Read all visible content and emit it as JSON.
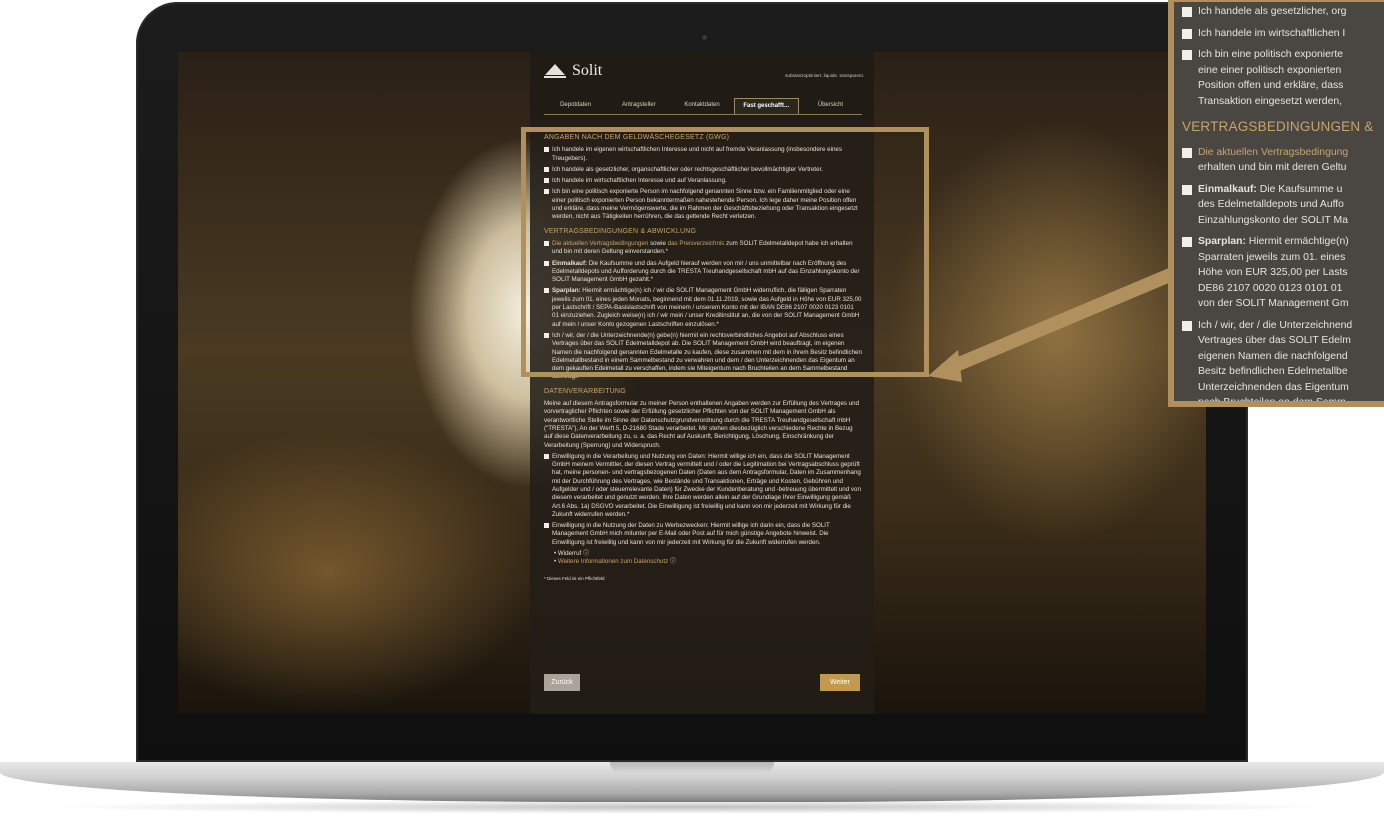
{
  "brand": {
    "name": "Solit",
    "slogan": "substanzoptimiert. liquide. transparent."
  },
  "tabs": [
    {
      "label": "Depotdaten"
    },
    {
      "label": "Antragsteller"
    },
    {
      "label": "Kontaktdaten"
    },
    {
      "label": "Fast geschafft..."
    },
    {
      "label": "Übersicht"
    }
  ],
  "form": {
    "gwg_title": "ANGABEN NACH DEM GELDWÄSCHEGESETZ (GWG)",
    "gwg_items": [
      "Ich handele im eigenen wirtschaftlichen Interesse und nicht auf fremde Veranlassung (insbesondere eines Treugebers).",
      "Ich handele als gesetzlicher, organschaftlicher oder rechtsgeschäftlicher bevollmächtigter Vertreter.",
      "Ich handele im wirtschaftlichen Interesse und auf Veranlassung.",
      "Ich bin eine politisch exponierte Person im nachfolgend genannten Sinne bzw. ein Familienmitglied oder eine einer politisch exponierten Person bekanntermaßen nahestehende Person. Ich lege daher meine Position offen und erkläre, dass meine Vermögenswerte, die im Rahmen der Geschäftsbeziehung oder Transaktion eingesetzt werden, nicht aus Tätigkeiten herrühren, die das geltende Recht verletzen."
    ],
    "contract_title": "VERTRAGSBEDINGUNGEN & ABWICKLUNG",
    "contract_item1_link1": "Die aktuellen Vertragsbedingungen",
    "contract_item1_mid": "sowie",
    "contract_item1_link2": "das Preisverzeichnis",
    "contract_item1_rest": "zum SOLIT Edelmetalldepot habe ich erhalten und bin mit deren Geltung einverstanden.*",
    "contract_item2_bold": "Einmalkauf:",
    "contract_item2_rest": "Die Kaufsumme und das Aufgeld hierauf werden von mir / uns unmittelbar nach Eröffnung des Edelmetalldepots und Aufforderung durch die TRESTA Treuhandgesellschaft mbH auf das Einzahlungskonto der SOLIT Management GmbH gezahlt.*",
    "contract_item3_bold": "Sparplan:",
    "contract_item3_rest": "Hiermit ermächtige(n) ich / wir die SOLIT Management GmbH widerruflich, die fälligen Sparraten jeweils zum 01. eines jeden Monats, beginnend mit dem 01.11.2019, sowie das Aufgeld in Höhe von EUR 325,00 per Lastschrift / SEPA-Basislastschrift von meinem / unserem Konto mit der IBAN DE86 2107 0020 0123 0101 01 einzuziehen. Zugleich weise(n) ich / wir mein / unser Kreditinstitut an, die von der SOLIT Management GmbH auf mein / unser Konto gezogenen Lastschriften einzulösen.*",
    "contract_item4": "Ich / wir, der / die Unterzeichnende(n) gebe(n) hiermit ein rechtsverbindliches Angebot auf Abschluss eines Vertrages über das SOLIT Edelmetalldepot ab. Die SOLIT Management GmbH wird beauftragt, im eigenen Namen die nachfolgend genannten Edelmetalle zu kaufen, diese zusammen mit dem in ihrem Besitz befindlichen Edelmetallbestand in einem Sammelbestand zu verwahren und dem / den Unterzeichnenden das Eigentum an dem gekauften Edelmetall zu verschaffen, indem sie Miteigentum nach Bruchteilen an dem Sammelbestand überträgt.",
    "data_title": "DATENVERARBEITUNG",
    "data_text": "Meine auf diesem Antragsformular zu meiner Person enthaltenen Angaben werden zur Erfüllung des Vertrages und vorvertraglicher Pflichten sowie der Erfüllung gesetzlicher Pflichten von der SOLIT Management GmbH als verantwortliche Stelle im Sinne der Datenschutzgrundverordnung durch die TRESTA Treuhandgesellschaft mbH (\"TRESTA\"), An der Werft 5, D-21680 Stade verarbeitet. Mir stehen diesbezüglich verschiedene Rechte in Bezug auf diese Datenverarbeitung zu, u. a. das Recht auf Auskunft, Berichtigung, Löschung, Einschränkung der Verarbeitung (Sperrung) und Widerspruch.",
    "data_item1": "Einwilligung in die Verarbeitung und Nutzung von Daten: Hiermit willige ich ein, dass die SOLIT Management GmbH meinem Vermittler, der diesen Vertrag vermittelt und / oder die Legitimation bei Vertragsabschluss geprüft hat, meine personen- und vertragsbezogenen Daten (Daten aus dem Antragsformular, Daten im Zusammenhang mit der Durchführung des Vertrages, wie Bestände und Transaktionen, Erträge und Kosten, Gebühren und Aufgelder und / oder steuerrelevante Daten) für Zwecke der Kundenberatung und -betreuung übermittelt und von diesem verarbeitet und genutzt werden. Ihre Daten werden allein auf der Grundlage Ihrer Einwilligung gemäß Art.6 Abs. 1a) DSGVO verarbeitet. Die Einwilligung ist freiwillig und kann von mir jederzeit mit Wirkung für die Zukunft widerrufen werden.*",
    "data_item2": "Einwilligung in die Nutzung der Daten zu Werbezwecken: Hiermit willige ich darin ein, dass die SOLIT Management GmbH mich mitunter per E-Mail oder Post auf für mich günstige Angebote hinweist. Die Einwilligung ist freiwillig und kann von mir jederzeit mit Wirkung für die Zukunft widerrufen werden.",
    "bullet1": "Widerruf",
    "bullet2": "Weitere Informationen zum Datenschutz",
    "required_note": "* Dieses Feld ist ein Pflichtfeld",
    "back_label": "Zurück",
    "next_label": "Weiter"
  },
  "zoom": {
    "line1": "Ich handele als gesetzlicher, org",
    "line2": "Ich handele im wirtschaftlichen I",
    "line3a": "Ich bin eine politisch exponierte",
    "line3b": "eine einer politisch exponierten",
    "line3c": "Position offen und erkläre, dass",
    "line3d": "Transaktion eingesetzt werden,",
    "section": "VERTRAGSBEDINGUNGEN &",
    "c1a": "Die aktuellen Vertragsbedingung",
    "c1b": "erhalten und bin mit deren Geltu",
    "c2a_bold": "Einmalkauf:",
    "c2a": " Die Kaufsumme u",
    "c2b": "des Edelmetalldepots und Auffo",
    "c2c": "Einzahlungskonto der SOLIT Ma",
    "c3a_bold": "Sparplan:",
    "c3a": " Hiermit ermächtige(n)",
    "c3b": "Sparraten jeweils zum 01. eines",
    "c3c": "Höhe von EUR 325,00 per Lasts",
    "c3d": "DE86 2107 0020 0123 0101 01",
    "c3e": "von der SOLIT Management Gm",
    "c4a": "Ich / wir, der / die Unterzeichnend",
    "c4b": "Vertrages über das SOLIT Edelm",
    "c4c": "eigenen Namen die nachfolgend",
    "c4d": "Besitz befindlichen Edelmetallbe",
    "c4e": "Unterzeichnenden das Eigentum",
    "c4f": "nach Bruchteilen an dem Samm"
  },
  "colors": {
    "accent": "#b0915e",
    "gold_text": "#c9a466",
    "button_next": "#c2994f",
    "button_back": "#a9a39a"
  }
}
